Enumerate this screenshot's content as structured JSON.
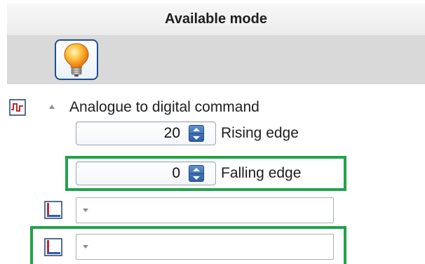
{
  "panel": {
    "title": "Available mode"
  },
  "mode_icon": {
    "name": "lightbulb-icon"
  },
  "section": {
    "label": "Analogue to digital command",
    "icon": "square-wave-signal-icon",
    "expanded": true
  },
  "rising_edge": {
    "value": "20",
    "label": "Rising edge"
  },
  "falling_edge": {
    "value": "0",
    "label": "Falling edge"
  },
  "combos": [
    {
      "icon": "object-selector-icon",
      "value": ""
    },
    {
      "icon": "object-selector-icon",
      "value": ""
    }
  ],
  "colors": {
    "highlight": "#21a34a",
    "accent": "#2e5fa5",
    "header_bg": "#d9d9d9",
    "signal_icon": "#c0282d"
  }
}
